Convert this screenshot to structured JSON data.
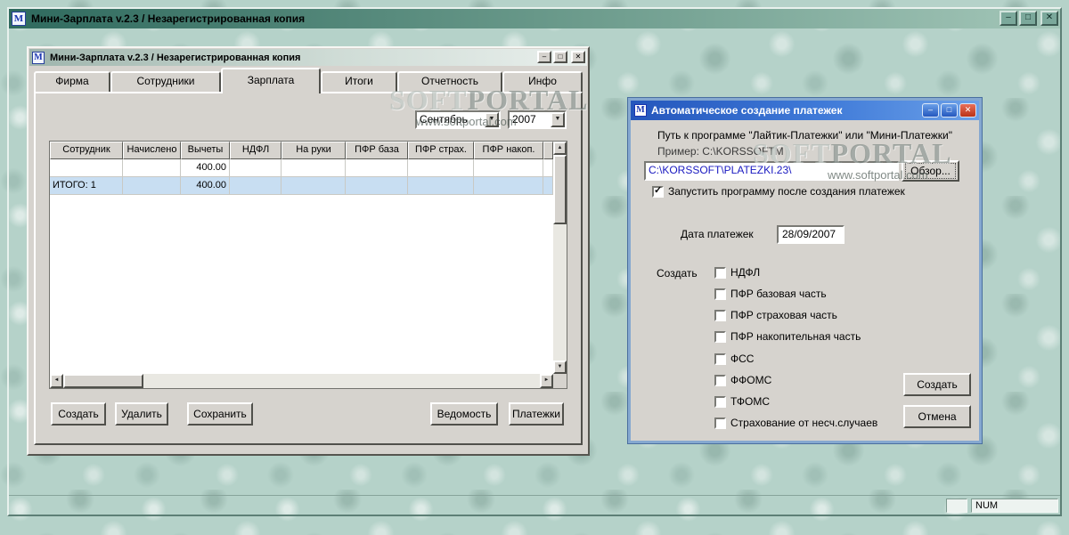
{
  "icons": {
    "app": "M",
    "minimize": "–",
    "maximize": "□",
    "close": "✕",
    "dropdown": "▼",
    "scroll_up": "▲",
    "scroll_down": "▼",
    "scroll_left": "◄",
    "scroll_right": "►",
    "check": "✓"
  },
  "main_window": {
    "title": "Мини-Зарплата v.2.3 / Незарегистрированная копия",
    "statusbar": {
      "num_indicator": "NUM"
    }
  },
  "child_window": {
    "title": "Мини-Зарплата v.2.3 / Незарегистрированная копия",
    "tabs": [
      "Фирма",
      "Сотрудники",
      "Зарплата",
      "Итоги",
      "Отчетность",
      "Инфо"
    ],
    "active_tab": "Зарплата",
    "month_value": "Сентябрь",
    "year_value": "2007",
    "table": {
      "columns": [
        "Сотрудник",
        "Начислено",
        "Вычеты",
        "НДФЛ",
        "На руки",
        "ПФР база",
        "ПФР страх.",
        "ПФР накоп."
      ],
      "rows": [
        {
          "cells": [
            "",
            "",
            "400.00",
            "",
            "",
            "",
            "",
            ""
          ]
        },
        {
          "cells": [
            "ИТОГО: 1",
            "",
            "400.00",
            "",
            "",
            "",
            "",
            ""
          ],
          "highlighted": true
        }
      ]
    },
    "buttons": {
      "create": "Создать",
      "delete": "Удалить",
      "save": "Сохранить",
      "sheet": "Ведомость",
      "payments": "Платежки"
    }
  },
  "dialog": {
    "title": "Автоматическое создание платежек",
    "path_caption": "Путь к программе \"Лайтик-Платежки\" или \"Мини-Платежки\"",
    "example_caption": "Пример: C:\\KORSSOFTM",
    "path_value": "C:\\KORSSOFT\\PLATEZKI.23\\",
    "browse_button": "Обзор...",
    "run_after_label": "Запустить программу после создания платежек",
    "run_after_checked": true,
    "date_label": "Дата платежек",
    "date_value": "28/09/2007",
    "create_label": "Создать",
    "create_checkboxes": [
      "НДФЛ",
      "ПФР базовая часть",
      "ПФР страховая часть",
      "ПФР накопительная часть",
      "ФСС",
      "ФФОМС",
      "ТФОМС",
      "Страхование от несч.случаев"
    ],
    "create_button": "Создать",
    "cancel_button": "Отмена"
  },
  "watermark": {
    "part1": "SOFT",
    "part2": "PORTAL",
    "url": "www.softportal.com"
  },
  "colors": {
    "title_teal": "#2f6a5e",
    "dialog_blue": "#2456bc",
    "selection_blue": "#c8def2",
    "window_face": "#d6d3ce"
  }
}
